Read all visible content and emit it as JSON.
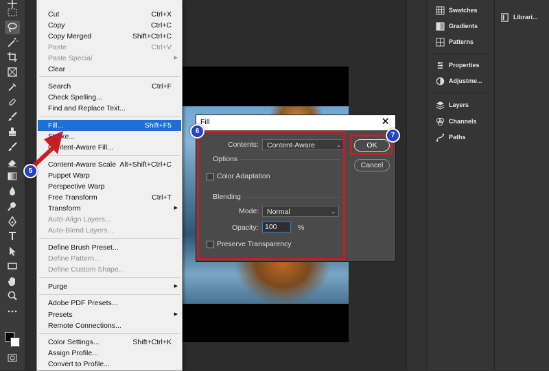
{
  "toolbar": {
    "tools": [
      {
        "name": "move-tool-icon"
      },
      {
        "name": "marquee-tool-icon"
      },
      {
        "name": "lasso-tool-icon"
      },
      {
        "name": "magic-wand-tool-icon"
      },
      {
        "name": "crop-tool-icon"
      },
      {
        "name": "frame-tool-icon"
      },
      {
        "name": "eyedropper-tool-icon"
      },
      {
        "name": "healing-brush-tool-icon"
      },
      {
        "name": "brush-tool-icon"
      },
      {
        "name": "clone-stamp-tool-icon"
      },
      {
        "name": "history-brush-tool-icon"
      },
      {
        "name": "eraser-tool-icon"
      },
      {
        "name": "gradient-tool-icon"
      },
      {
        "name": "blur-tool-icon"
      },
      {
        "name": "dodge-tool-icon"
      },
      {
        "name": "pen-tool-icon"
      },
      {
        "name": "type-tool-icon"
      },
      {
        "name": "path-selection-tool-icon"
      },
      {
        "name": "rectangle-tool-icon"
      },
      {
        "name": "hand-tool-icon"
      },
      {
        "name": "zoom-tool-icon"
      },
      {
        "name": "more-tools-icon"
      }
    ],
    "active_tool": "lasso-tool-icon",
    "foreground_color": "#000000",
    "background_color": "#ffffff"
  },
  "edit_menu": {
    "items": [
      {
        "label": "Cut",
        "shortcut": "Ctrl+X"
      },
      {
        "label": "Copy",
        "shortcut": "Ctrl+C"
      },
      {
        "label": "Copy Merged",
        "shortcut": "Shift+Ctrl+C"
      },
      {
        "label": "Paste",
        "shortcut": "Ctrl+V"
      },
      {
        "label": "Paste Special",
        "shortcut": ""
      },
      {
        "label": "Clear",
        "shortcut": ""
      },
      {
        "label": "Search",
        "shortcut": "Ctrl+F"
      },
      {
        "label": "Check Spelling...",
        "shortcut": ""
      },
      {
        "label": "Find and Replace Text...",
        "shortcut": ""
      },
      {
        "label": "Fill...",
        "shortcut": "Shift+F5"
      },
      {
        "label": "Stroke...",
        "shortcut": ""
      },
      {
        "label": "Content-Aware Fill...",
        "shortcut": ""
      },
      {
        "label": "Content-Aware Scale",
        "shortcut": "Alt+Shift+Ctrl+C"
      },
      {
        "label": "Puppet Warp",
        "shortcut": ""
      },
      {
        "label": "Perspective Warp",
        "shortcut": ""
      },
      {
        "label": "Free Transform",
        "shortcut": "Ctrl+T"
      },
      {
        "label": "Transform",
        "shortcut": ""
      },
      {
        "label": "Auto-Align Layers...",
        "shortcut": ""
      },
      {
        "label": "Auto-Blend Layers...",
        "shortcut": ""
      },
      {
        "label": "Define Brush Preset...",
        "shortcut": ""
      },
      {
        "label": "Define Pattern...",
        "shortcut": ""
      },
      {
        "label": "Define Custom Shape...",
        "shortcut": ""
      },
      {
        "label": "Purge",
        "shortcut": ""
      },
      {
        "label": "Adobe PDF Presets...",
        "shortcut": ""
      },
      {
        "label": "Presets",
        "shortcut": ""
      },
      {
        "label": "Remote Connections...",
        "shortcut": ""
      },
      {
        "label": "Color Settings...",
        "shortcut": "Shift+Ctrl+K"
      },
      {
        "label": "Assign Profile...",
        "shortcut": ""
      },
      {
        "label": "Convert to Profile...",
        "shortcut": ""
      }
    ]
  },
  "fill_dialog": {
    "title": "Fill",
    "close_glyph": "✕",
    "contents_label": "Contents:",
    "contents_value": "Content-Aware",
    "options_label": "Options",
    "color_adaptation_label": "Color Adaptation",
    "blending_label": "Blending",
    "mode_label": "Mode:",
    "mode_value": "Normal",
    "opacity_label": "Opacity:",
    "opacity_value": "100",
    "opacity_unit": "%",
    "preserve_transparency_label": "Preserve Transparency",
    "ok_label": "OK",
    "cancel_label": "Cancel"
  },
  "panels": {
    "col1": [
      {
        "label": "Swatches",
        "icon": "swatches-icon"
      },
      {
        "label": "Gradients",
        "icon": "gradients-icon"
      },
      {
        "label": "Patterns",
        "icon": "patterns-icon"
      },
      {
        "label": "Properties",
        "icon": "properties-icon"
      },
      {
        "label": "Adjustme...",
        "icon": "adjustments-icon"
      },
      {
        "label": "Layers",
        "icon": "layers-icon"
      },
      {
        "label": "Channels",
        "icon": "channels-icon"
      },
      {
        "label": "Paths",
        "icon": "paths-icon"
      }
    ],
    "col2": [
      {
        "label": "Librari...",
        "icon": "libraries-icon"
      }
    ]
  },
  "annotations": {
    "step5": "5",
    "step6": "6",
    "step7": "7",
    "highlight_color": "#c81e23",
    "badge_color": "#2742c8"
  }
}
